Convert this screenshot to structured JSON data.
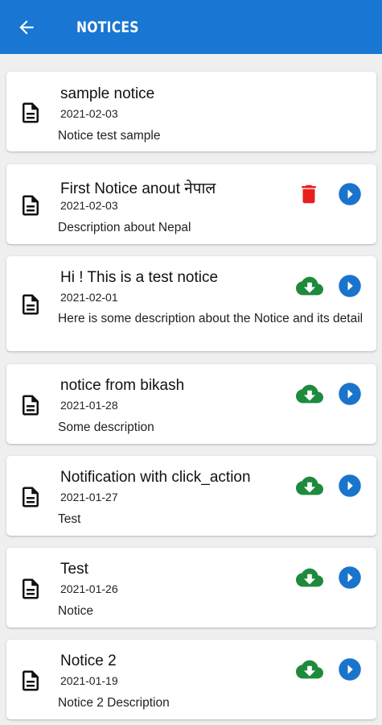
{
  "header": {
    "title": "NOTICES",
    "back_icon": "arrow-left-icon",
    "color": "#1976d2"
  },
  "icons": {
    "document": "document-icon",
    "delete": "trash-icon",
    "download": "cloud-download-icon",
    "open": "play-circle-icon"
  },
  "colors": {
    "delete": "#e8201b",
    "download": "#1e8a3c",
    "open": "#1a74cc"
  },
  "notices": [
    {
      "title": "sample notice",
      "date": "2021-02-03",
      "description": "Notice test sample",
      "actions": []
    },
    {
      "title": "First Notice anout नेपाल",
      "date": "2021-02-03",
      "description": "Description about Nepal",
      "actions": [
        "delete",
        "open"
      ]
    },
    {
      "title": "Hi ! This is a test notice",
      "date": "2021-02-01",
      "description": "Here is some description about the Notice and its detail",
      "actions": [
        "download",
        "open"
      ]
    },
    {
      "title": "notice from bikash",
      "date": "2021-01-28",
      "description": "Some description",
      "actions": [
        "download",
        "open"
      ]
    },
    {
      "title": "Notification with click_action",
      "date": "2021-01-27",
      "description": "Test",
      "actions": [
        "download",
        "open"
      ]
    },
    {
      "title": "Test",
      "date": "2021-01-26",
      "description": "Notice",
      "actions": [
        "download",
        "open"
      ]
    },
    {
      "title": "Notice 2",
      "date": "2021-01-19",
      "description": "Notice 2 Description",
      "actions": [
        "download",
        "open"
      ]
    }
  ]
}
